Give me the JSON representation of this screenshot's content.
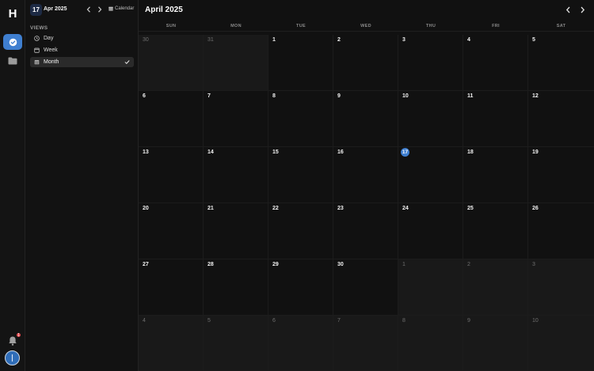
{
  "app": {
    "logo_letter": "H"
  },
  "rail": {
    "notification_count": "1"
  },
  "sidebar": {
    "date_chip": "17",
    "date_label": "Apr 2025",
    "calendar_link": "Calendar",
    "views_title": "VIEWS",
    "views": [
      {
        "label": "Day",
        "icon": "clock-icon",
        "selected": false
      },
      {
        "label": "Week",
        "icon": "calendar-week-icon",
        "selected": false
      },
      {
        "label": "Month",
        "icon": "calendar-month-icon",
        "selected": true
      }
    ]
  },
  "main": {
    "title": "April 2025",
    "weekdays": [
      "SUN",
      "MON",
      "TUE",
      "WED",
      "THU",
      "FRI",
      "SAT"
    ],
    "today": "17",
    "accent_color": "#3f7fd0",
    "days": [
      {
        "n": "30",
        "out": true
      },
      {
        "n": "31",
        "out": true
      },
      {
        "n": "1",
        "out": false
      },
      {
        "n": "2",
        "out": false
      },
      {
        "n": "3",
        "out": false
      },
      {
        "n": "4",
        "out": false
      },
      {
        "n": "5",
        "out": false
      },
      {
        "n": "6",
        "out": false
      },
      {
        "n": "7",
        "out": false
      },
      {
        "n": "8",
        "out": false
      },
      {
        "n": "9",
        "out": false
      },
      {
        "n": "10",
        "out": false
      },
      {
        "n": "11",
        "out": false
      },
      {
        "n": "12",
        "out": false
      },
      {
        "n": "13",
        "out": false
      },
      {
        "n": "14",
        "out": false
      },
      {
        "n": "15",
        "out": false
      },
      {
        "n": "16",
        "out": false
      },
      {
        "n": "17",
        "out": false
      },
      {
        "n": "18",
        "out": false
      },
      {
        "n": "19",
        "out": false
      },
      {
        "n": "20",
        "out": false
      },
      {
        "n": "21",
        "out": false
      },
      {
        "n": "22",
        "out": false
      },
      {
        "n": "23",
        "out": false
      },
      {
        "n": "24",
        "out": false
      },
      {
        "n": "25",
        "out": false
      },
      {
        "n": "26",
        "out": false
      },
      {
        "n": "27",
        "out": false
      },
      {
        "n": "28",
        "out": false
      },
      {
        "n": "29",
        "out": false
      },
      {
        "n": "30",
        "out": false
      },
      {
        "n": "1",
        "out": true
      },
      {
        "n": "2",
        "out": true
      },
      {
        "n": "3",
        "out": true
      },
      {
        "n": "4",
        "out": true
      },
      {
        "n": "5",
        "out": true
      },
      {
        "n": "6",
        "out": true
      },
      {
        "n": "7",
        "out": true
      },
      {
        "n": "8",
        "out": true
      },
      {
        "n": "9",
        "out": true
      },
      {
        "n": "10",
        "out": true
      }
    ]
  }
}
